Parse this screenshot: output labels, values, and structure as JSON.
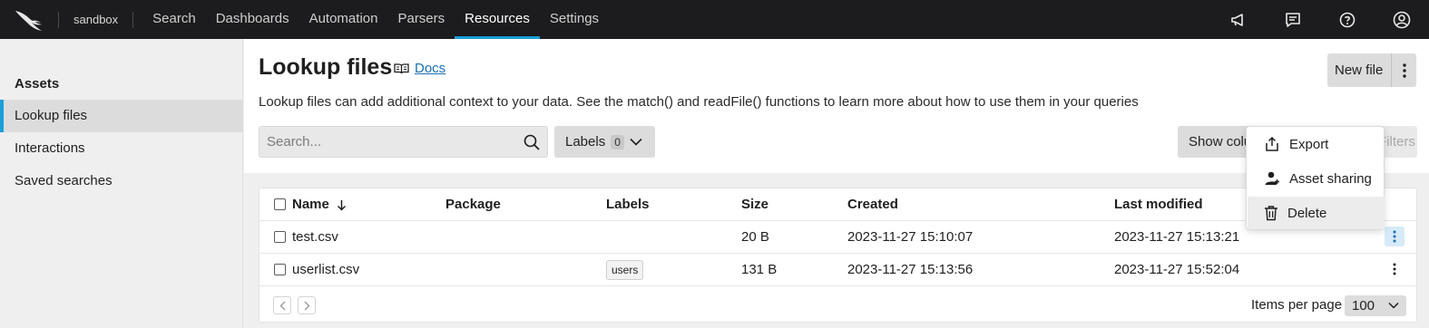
{
  "topbar": {
    "workspace": "sandbox",
    "nav": [
      "Search",
      "Dashboards",
      "Automation",
      "Parsers",
      "Resources",
      "Settings"
    ],
    "active_nav": "Resources",
    "icons": [
      "megaphone-icon",
      "chat-icon",
      "help-icon",
      "user-icon"
    ]
  },
  "sidebar": {
    "title": "Assets",
    "items": [
      {
        "label": "Lookup files",
        "active": true
      },
      {
        "label": "Interactions",
        "active": false
      },
      {
        "label": "Saved searches",
        "active": false
      }
    ]
  },
  "header": {
    "title": "Lookup files",
    "docs_label": "Docs",
    "description": "Lookup files can add additional context to your data. See the match() and readFile() functions to learn more about how to use them in your queries",
    "new_file_label": "New file"
  },
  "toolbar": {
    "search_placeholder": "Search...",
    "labels_label": "Labels",
    "labels_count": "0",
    "show_columns_label": "Show columns",
    "filter_label": "Filters"
  },
  "table": {
    "columns": [
      "Name",
      "Package",
      "Labels",
      "Size",
      "Created",
      "Last modified"
    ],
    "rows": [
      {
        "name": "test.csv",
        "package": "",
        "labels": "",
        "size": "20 B",
        "created": "2023-11-27 15:10:07",
        "modified": "2023-11-27 15:13:21"
      },
      {
        "name": "userlist.csv",
        "package": "",
        "labels": "users",
        "size": "131 B",
        "created": "2023-11-27 15:13:56",
        "modified": "2023-11-27 15:52:04"
      }
    ]
  },
  "pagination": {
    "items_per_page_label": "Items per page",
    "items_per_page_value": "100"
  },
  "context_menu": {
    "items": [
      {
        "label": "Export",
        "icon": "export-icon"
      },
      {
        "label": "Asset sharing",
        "icon": "share-user-icon"
      },
      {
        "label": "Delete",
        "icon": "trash-icon"
      }
    ]
  },
  "colors": {
    "accent": "#1a9fd8",
    "topbar_bg": "#1c1c1e",
    "link": "#1a6fb0"
  }
}
